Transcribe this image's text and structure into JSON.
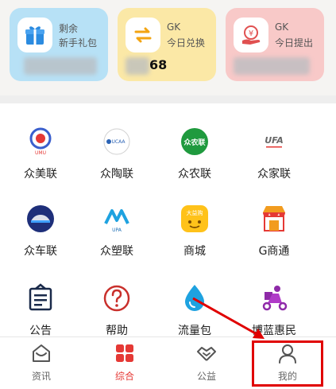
{
  "cards": [
    {
      "icon": "gift-icon",
      "line1": "剩余",
      "line2": "新手礼包",
      "value": "",
      "color": "#b7e1f6"
    },
    {
      "icon": "exchange-icon",
      "line1": "GK",
      "line2": "今日兑换",
      "value": "68",
      "color": "#fbe8a6"
    },
    {
      "icon": "yuan-withdraw-icon",
      "line1": "GK",
      "line2": "今日提出",
      "value": "",
      "color": "#f8c9c8"
    }
  ],
  "grid": [
    {
      "label": "众美联",
      "icon": "umu-logo-icon"
    },
    {
      "label": "众陶联",
      "icon": "ucaa-logo-icon"
    },
    {
      "label": "众农联",
      "icon": "zhongnonglian-logo-icon"
    },
    {
      "label": "众家联",
      "icon": "ufa-logo-icon"
    },
    {
      "label": "众车联",
      "icon": "car-logo-icon"
    },
    {
      "label": "众塑联",
      "icon": "upa-logo-icon"
    },
    {
      "label": "商城",
      "icon": "mall-icon"
    },
    {
      "label": "G商通",
      "icon": "shop-stall-icon"
    },
    {
      "label": "公告",
      "icon": "announcement-icon"
    },
    {
      "label": "帮助",
      "icon": "help-icon"
    },
    {
      "label": "流量包",
      "icon": "water-drop-icon"
    },
    {
      "label": "博蓝惠民",
      "icon": "delivery-scooter-icon"
    }
  ],
  "card_logo_texts": {
    "umu": "UMU",
    "ucaa": "UCAA",
    "zn": "众农联",
    "ufa": "UFA",
    "upa": "UPA",
    "mall": "大益购"
  },
  "tabs": [
    {
      "label": "资讯",
      "icon": "home-icon"
    },
    {
      "label": "综合",
      "icon": "grid-icon",
      "active": true
    },
    {
      "label": "公益",
      "icon": "handshake-icon"
    },
    {
      "label": "我的",
      "icon": "user-icon"
    }
  ],
  "colors": {
    "accent": "#e53935",
    "highlight": "#e00000"
  }
}
